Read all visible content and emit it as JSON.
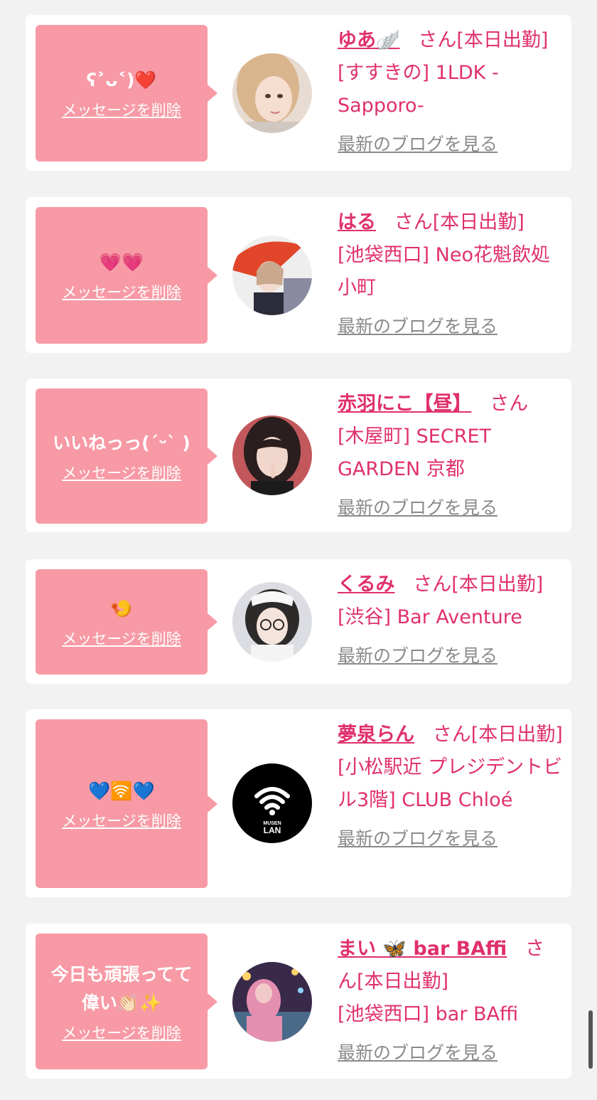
{
  "common": {
    "delete_label": "メッセージを削除",
    "blog_label": "最新のブログを見る",
    "san_label": "さん",
    "accent_color": "#e0306e",
    "bubble_color": "#f79aa5"
  },
  "items": [
    {
      "message": "ʕ˃ᴗ˂)❤️",
      "name": "ゆあ",
      "name_emoji": "🪽",
      "status": "[本日出勤]",
      "shop": "[すすきの] 1LDK -Sapporo-"
    },
    {
      "message": "💗💗",
      "name": "はる",
      "name_emoji": "",
      "status": "[本日出勤]",
      "shop": "[池袋西口] Neo花魁飲処 小町"
    },
    {
      "message": "いいねっっ(ˊᵕˋ )",
      "name": "赤羽にこ【昼】",
      "name_emoji": "",
      "status": "",
      "shop": "[木屋町] SECRET GARDEN 京都"
    },
    {
      "message": "🍤",
      "name": "くるみ",
      "name_emoji": "",
      "status": "[本日出勤]",
      "shop": "[渋谷] Bar Aventure"
    },
    {
      "message": "💙🛜💙",
      "name": "夢泉らん",
      "name_emoji": "",
      "status": "[本日出勤]",
      "shop": "[小松駅近 プレジデントビル3階] CLUB Chloé",
      "avatar_text_1": "MUSEN",
      "avatar_text_2": "LAN"
    },
    {
      "message": "今日も頑張ってて偉い👏🏻✨",
      "name": "まい 🦋 bar BAffi",
      "name_emoji": "",
      "status": "[本日出勤]",
      "shop": "[池袋西口] bar BAffi"
    }
  ]
}
